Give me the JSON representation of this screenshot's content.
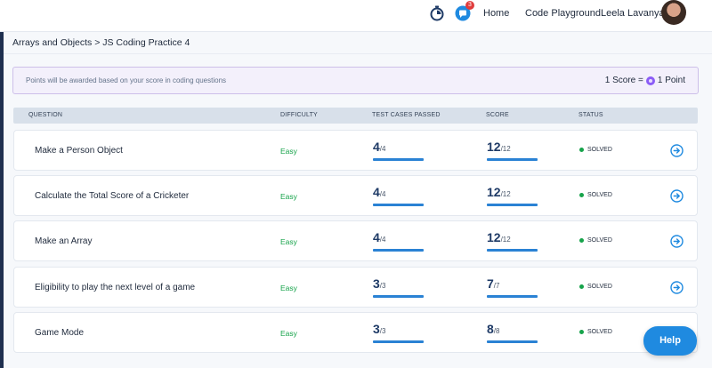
{
  "nav": {
    "notifications_count": "3",
    "links": [
      "Home",
      "Code Playground"
    ],
    "user_name": "Leela Lavanya"
  },
  "breadcrumb": "Arrays and Objects > JS Coding Practice 4",
  "banner": {
    "text": "Points will be awarded based on your score in coding questions",
    "rule_left": "1 Score =",
    "rule_right": "1 Point"
  },
  "table": {
    "headers": [
      "QUESTION",
      "DIFFICULTY",
      "TEST CASES PASSED",
      "SCORE",
      "STATUS"
    ],
    "rows": [
      {
        "question": "Make a Person Object",
        "difficulty": "Easy",
        "tests_passed": "4",
        "tests_total": "/4",
        "score": "12",
        "score_max": "/12",
        "status": "SOLVED"
      },
      {
        "question": "Calculate the Total Score of a Cricketer",
        "difficulty": "Easy",
        "tests_passed": "4",
        "tests_total": "/4",
        "score": "12",
        "score_max": "/12",
        "status": "SOLVED"
      },
      {
        "question": "Make an Array",
        "difficulty": "Easy",
        "tests_passed": "4",
        "tests_total": "/4",
        "score": "12",
        "score_max": "/12",
        "status": "SOLVED"
      },
      {
        "question": "Eligibility to play the next level of a game",
        "difficulty": "Easy",
        "tests_passed": "3",
        "tests_total": "/3",
        "score": "7",
        "score_max": "/7",
        "status": "SOLVED"
      },
      {
        "question": "Game Mode",
        "difficulty": "Easy",
        "tests_passed": "3",
        "tests_total": "/3",
        "score": "8",
        "score_max": "/8",
        "status": "SOLVED"
      }
    ]
  },
  "help_label": "Help",
  "icons": {
    "timer": "stopwatch-icon",
    "chat": "chat-bubble-icon",
    "row_action": "arrow-circle-right-icon",
    "point": "coin-icon"
  },
  "colors": {
    "accent": "#1f8ae0",
    "easy": "#16a34a",
    "solved_dot": "#16a34a",
    "banner_bg": "#f3f0fb",
    "header_bg": "#d8e0ea",
    "notification": "#e03c3c"
  }
}
